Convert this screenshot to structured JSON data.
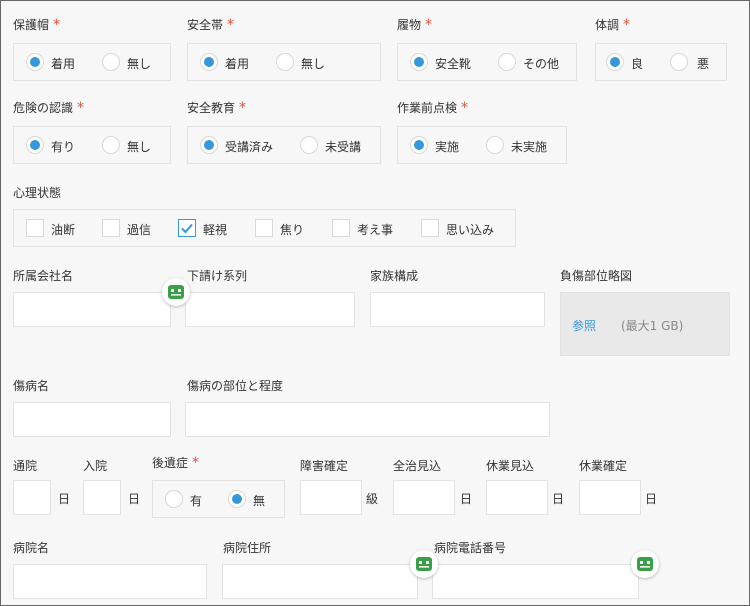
{
  "row1": {
    "helmet": {
      "label": "保護帽",
      "options": [
        "着用",
        "無し"
      ],
      "selected": 0
    },
    "harness": {
      "label": "安全帯",
      "options": [
        "着用",
        "無し"
      ],
      "selected": 0
    },
    "footwear": {
      "label": "履物",
      "options": [
        "安全靴",
        "その他"
      ],
      "selected": 0
    },
    "condition": {
      "label": "体調",
      "options": [
        "良",
        "悪"
      ],
      "selected": 0
    }
  },
  "row2": {
    "hazard": {
      "label": "危険の認識",
      "options": [
        "有り",
        "無し"
      ],
      "selected": 0
    },
    "training": {
      "label": "安全教育",
      "options": [
        "受講済み",
        "未受講"
      ],
      "selected": 0
    },
    "precheck": {
      "label": "作業前点検",
      "options": [
        "実施",
        "未実施"
      ],
      "selected": 0
    }
  },
  "mental": {
    "label": "心理状態",
    "options": [
      "油断",
      "過信",
      "軽視",
      "焦り",
      "考え事",
      "思い込み"
    ],
    "checked": [
      false,
      false,
      true,
      false,
      false,
      false
    ]
  },
  "row4": {
    "company_label": "所属会社名",
    "subcontract_label": "下請け系列",
    "family_label": "家族構成",
    "injury_map_label": "負傷部位略図",
    "browse_label": "参照",
    "max_size_label": "(最大1 GB)"
  },
  "row5": {
    "disease_label": "傷病名",
    "injury_detail_label": "傷病の部位と程度"
  },
  "row6": {
    "outpatient_label": "通院",
    "inpatient_label": "入院",
    "aftereffect_label": "後遺症",
    "aftereffect_options": [
      "有",
      "無"
    ],
    "aftereffect_selected": 1,
    "disability_label": "障害確定",
    "recovery_label": "全治見込",
    "leave_est_label": "休業見込",
    "leave_conf_label": "休業確定",
    "unit_day": "日",
    "unit_grade": "級"
  },
  "row7": {
    "hospital_label": "病院名",
    "hospital_addr_label": "病院住所",
    "hospital_tel_label": "病院電話番号"
  },
  "colors": {
    "accent": "#3498db",
    "required": "#e74c3c",
    "chip_icon": "#3aa047"
  }
}
